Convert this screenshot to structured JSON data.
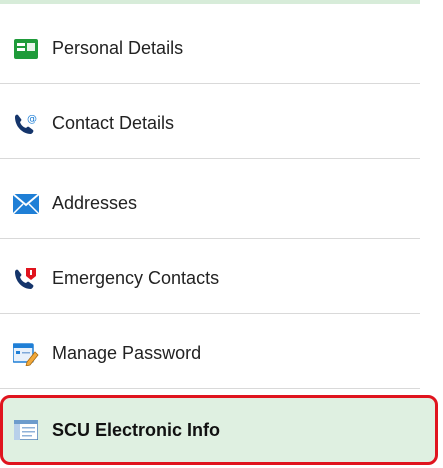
{
  "nav": {
    "items": [
      {
        "label": "Personal Details",
        "icon": "id-card-icon"
      },
      {
        "label": "Contact Details",
        "icon": "phone-email-icon"
      },
      {
        "label": "Addresses",
        "icon": "envelope-icon"
      },
      {
        "label": "Emergency Contacts",
        "icon": "phone-alert-icon"
      },
      {
        "label": "Manage Password",
        "icon": "form-edit-icon"
      },
      {
        "label": "SCU Electronic Info",
        "icon": "info-panel-icon",
        "selected": true
      }
    ]
  },
  "colors": {
    "selected_background": "#dff0e1",
    "selected_border": "#e0141e",
    "icon_green": "#1f9b3a",
    "icon_navy": "#15356b",
    "icon_blue": "#1f7fd6"
  }
}
